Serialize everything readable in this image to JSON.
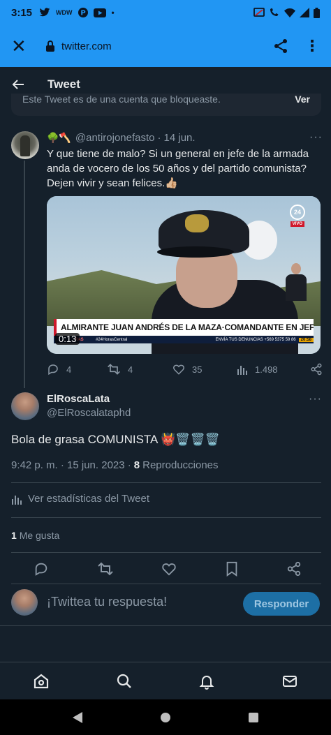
{
  "status_bar": {
    "time": "3:15"
  },
  "browser": {
    "url": "twitter.com"
  },
  "header": {
    "title": "Tweet"
  },
  "blocked_notice": {
    "text": "Este Tweet es de una cuenta que bloqueaste.",
    "action": "Ver"
  },
  "parent_tweet": {
    "emojis": "🌳🪓",
    "handle": "@antirojonefasto",
    "date": "14 jun.",
    "text": "Y que tiene de malo? Si un general en jefe de la armada anda de vocero de los 50 años y del partido comunista? Dejen vivir y sean felices.👍🏼",
    "video": {
      "caption": "ALMIRANTE JUAN ANDRÉS DE LA MAZA·COMANDANTE EN JEFE DE LA ARMADA",
      "ticker_left": "RAS",
      "ticker_tag": "#24HorasCentral",
      "ticker_phone": "ENVÍA TUS DENUNCIAS +569 5375 59 86",
      "clock": "20:58",
      "duration": "0:13",
      "logo": "24",
      "live": "VIVO"
    },
    "replies": "4",
    "retweets": "4",
    "likes": "35",
    "views": "1.498"
  },
  "main_tweet": {
    "name": "ElRoscaLata",
    "handle": "@ElRoscalataphd",
    "text": "Bola de grasa COMUNISTA 👹🗑️🗑️🗑️",
    "time_date": "9:42 p. m. · 15 jun. 2023 ·",
    "views": "8",
    "views_label": "Reproducciones",
    "stats_link": "Ver estadísticas del Tweet",
    "likes_count": "1",
    "likes_label": "Me gusta"
  },
  "reply_bar": {
    "placeholder": "¡Twittea tu respuesta!",
    "button": "Responder"
  }
}
